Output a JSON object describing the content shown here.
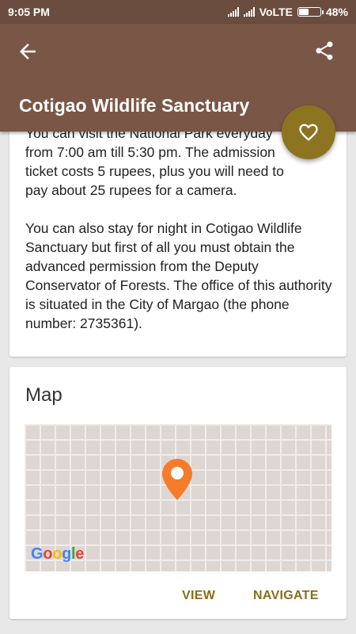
{
  "status_bar": {
    "time": "9:05 PM",
    "network": "VoLTE",
    "battery_percent": "48%",
    "battery_level": 0.48
  },
  "app_bar": {
    "title": "Cotigao Wildlife Sanctuary",
    "back_icon": "arrow-back-icon",
    "share_icon": "share-icon"
  },
  "fab": {
    "icon": "heart-outline-icon"
  },
  "description": {
    "lines_p1": [
      "You can visit the National Park everyday",
      "from 7:00 am till 5:30 pm. The admission",
      "ticket costs 5 rupees, plus you will need to",
      "pay about 25 rupees for a camera."
    ],
    "p2": "You can also stay for night in Cotigao Wildlife Sanctuary but first of all you must obtain the advanced permission from the Deputy Conservator of Forests. The office of this authority is situated in the City of Margao (the phone number: 2735361)."
  },
  "map_card": {
    "title": "Map",
    "logo_text": "Google",
    "view_label": "VIEW",
    "navigate_label": "NAVIGATE"
  },
  "colors": {
    "status_bar": "#6b4d3f",
    "app_bar": "#7a5646",
    "fab": "#8c7420",
    "accent": "#8a6d1c",
    "pin": "#f57c2a"
  }
}
